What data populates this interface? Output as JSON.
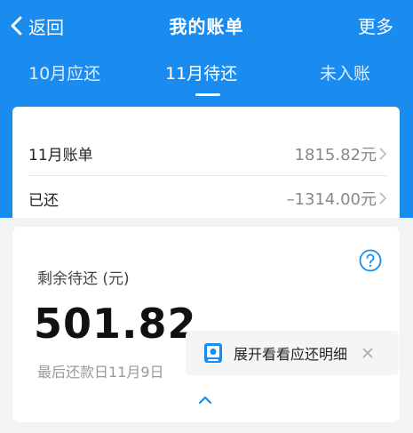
{
  "nav": {
    "back_label": "返回",
    "title": "我的账单",
    "more_label": "更多"
  },
  "tabs": [
    {
      "label": "10月应还"
    },
    {
      "label": "11月待还",
      "active": true
    },
    {
      "label": "未入账"
    }
  ],
  "bill": {
    "rows": [
      {
        "label": "11月账单",
        "value": "1815.82元"
      },
      {
        "label": "已还",
        "value": "–1314.00元"
      }
    ]
  },
  "remaining": {
    "label": "剩余待还 (元)",
    "amount": "501.82",
    "due_text": "最后还款日11月9日",
    "expand_text": "展开看看应还明细"
  },
  "colors": {
    "primary": "#1a8cf0",
    "card_bg": "#ffffff",
    "page_bg": "#f2f3f5"
  },
  "icons": [
    "chevron-left-icon",
    "chevron-right-icon",
    "help-icon",
    "document-icon",
    "close-icon",
    "chevron-up-icon"
  ]
}
